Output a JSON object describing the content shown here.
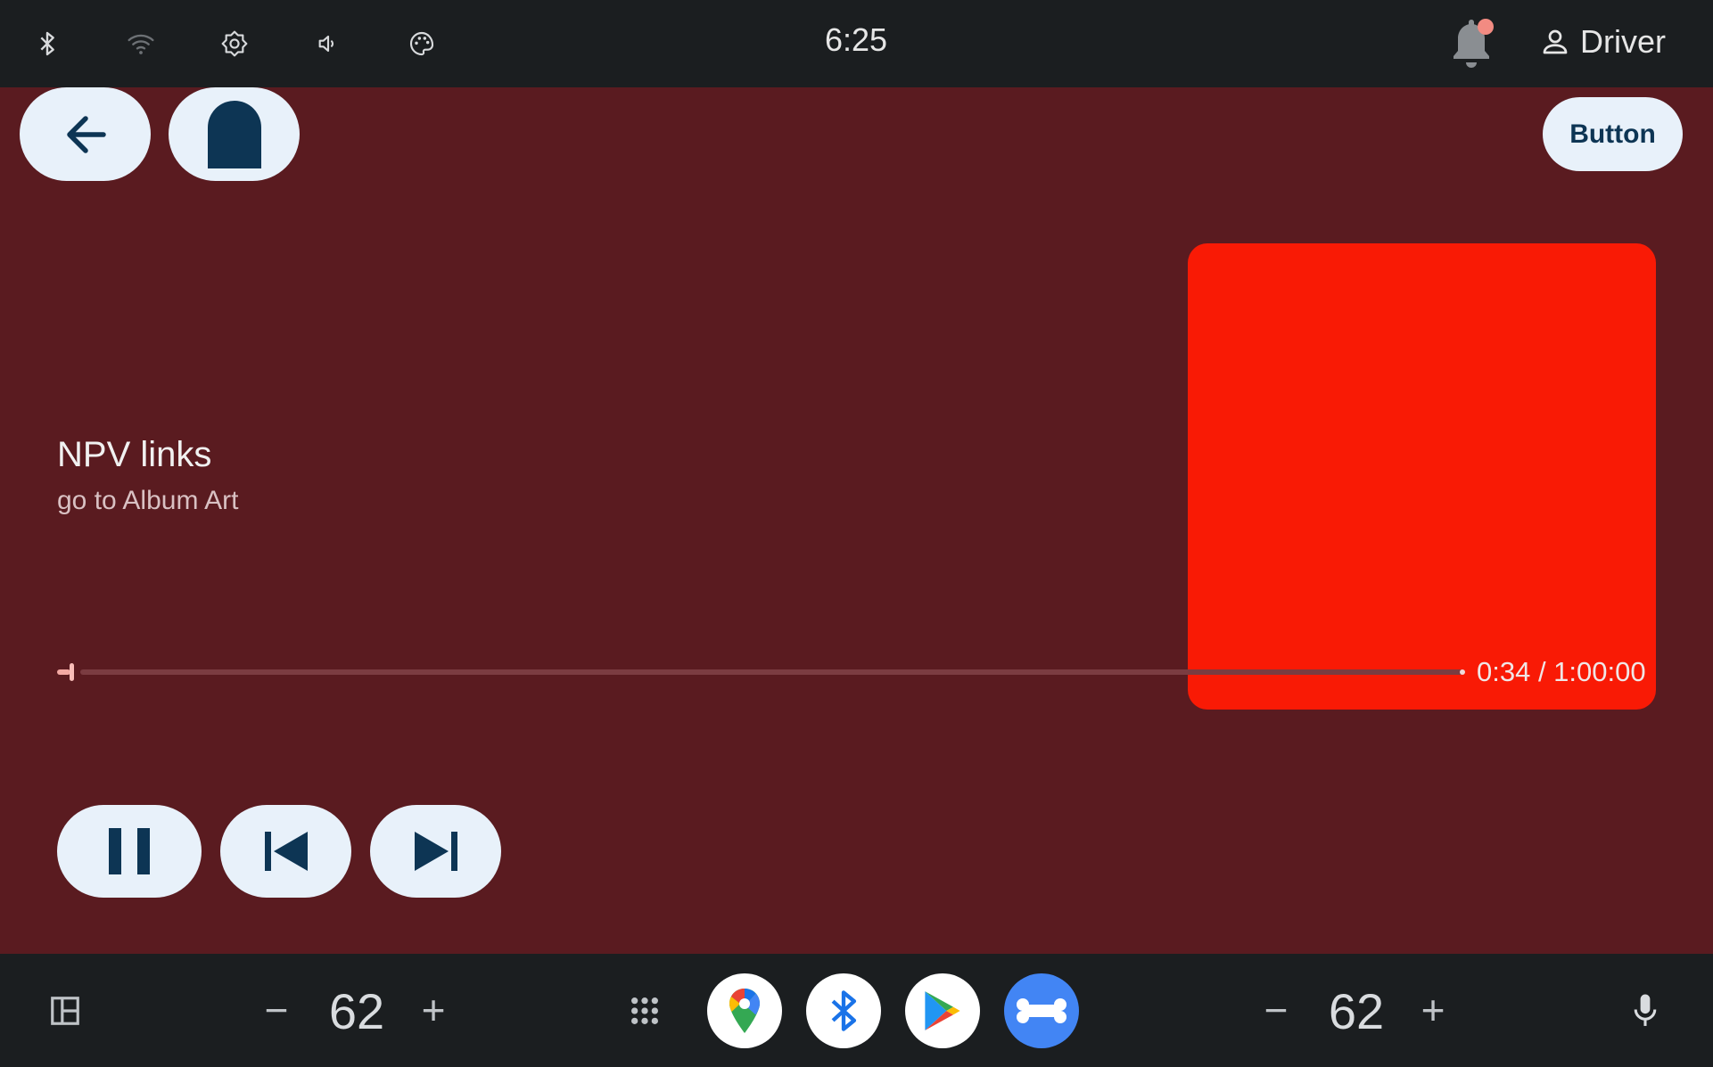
{
  "status_bar": {
    "clock": "6:25",
    "user_label": "Driver",
    "icons": [
      "bluetooth-icon",
      "wifi-icon",
      "brightness-icon",
      "volume-icon",
      "palette-icon",
      "notification-bell-icon",
      "user-icon"
    ]
  },
  "top_actions": {
    "back_icon": "arrow-left-icon",
    "browse_icon": "tombstone-icon",
    "button_label": "Button"
  },
  "now_playing": {
    "title": "NPV links",
    "subtitle": "go to Album Art",
    "album_art_color": "#f91a05",
    "progress_fraction": 0.0094,
    "time_readout": "0:34 / 1:00:00"
  },
  "playback_controls": {
    "icons": [
      "pause-icon",
      "skip-previous-icon",
      "skip-next-icon"
    ]
  },
  "bottom_bar": {
    "left_volume": {
      "minus": "−",
      "value": "62",
      "plus": "+"
    },
    "right_volume": {
      "minus": "−",
      "value": "62",
      "plus": "+"
    },
    "apps": [
      "maps-icon",
      "bluetooth-app-icon",
      "play-store-icon",
      "bone-app-icon"
    ],
    "icons": [
      "split-screen-icon",
      "app-grid-icon",
      "microphone-icon"
    ]
  },
  "colors": {
    "main_background": "#5a1b20",
    "bar_background": "#1b1e20",
    "pill_button": "#e8f1fa",
    "icon_dark": "#0d3554"
  }
}
